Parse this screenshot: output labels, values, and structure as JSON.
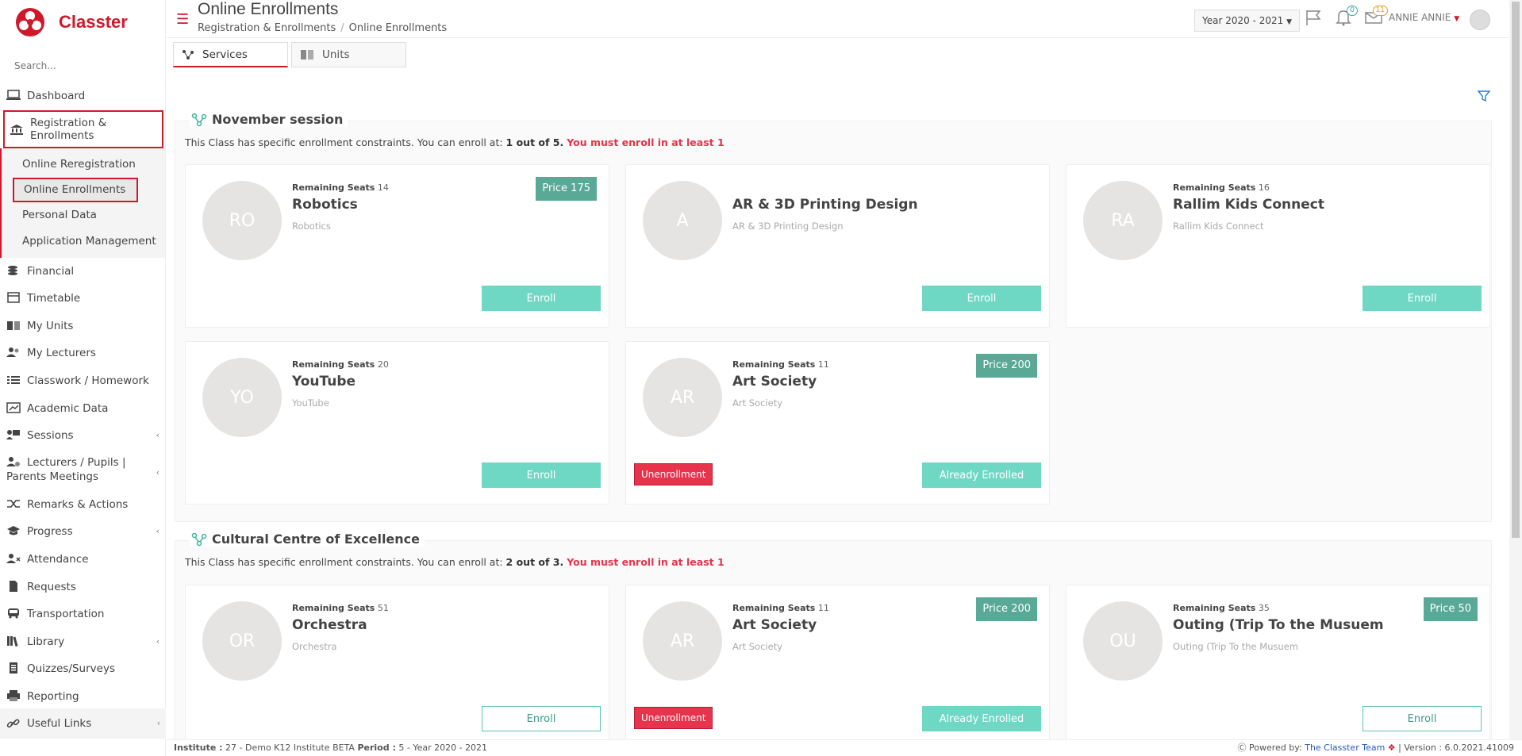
{
  "app": {
    "brand": "Classter"
  },
  "sidebar": {
    "search_placeholder": "Search...",
    "items": [
      {
        "label": "Dashboard"
      },
      {
        "label": "Registration & Enrollments"
      },
      {
        "label": "Financial"
      },
      {
        "label": "Timetable"
      },
      {
        "label": "My Units"
      },
      {
        "label": "My Lecturers"
      },
      {
        "label": "Classwork / Homework"
      },
      {
        "label": "Academic Data"
      },
      {
        "label": "Sessions"
      },
      {
        "label": "Lecturers / Pupils | Parents Meetings"
      },
      {
        "label": "Remarks & Actions"
      },
      {
        "label": "Progress"
      },
      {
        "label": "Attendance"
      },
      {
        "label": "Requests"
      },
      {
        "label": "Transportation"
      },
      {
        "label": "Library"
      },
      {
        "label": "Quizzes/Surveys"
      },
      {
        "label": "Reporting"
      }
    ],
    "sub_items": [
      {
        "label": "Online Reregistration"
      },
      {
        "label": "Online Enrollments"
      },
      {
        "label": "Personal Data"
      },
      {
        "label": "Application Management"
      }
    ],
    "useful_links": "Useful Links"
  },
  "header": {
    "title": "Online Enrollments",
    "breadcrumb": [
      "Registration & Enrollments",
      "Online Enrollments"
    ],
    "year_select": "Year 2020 - 2021",
    "notifications_count": "0",
    "messages_count": "11",
    "user_name": "ANNIE ANNIE"
  },
  "tabs": [
    {
      "label": "Services"
    },
    {
      "label": "Units"
    }
  ],
  "sessions": [
    {
      "title": "November session",
      "constraint_prefix": "This Class has specific enrollment constraints. You can enroll at:",
      "constraint_value": "1 out of 5.",
      "constraint_must": "You must enroll in at least 1",
      "cards": [
        {
          "initials": "RO",
          "seats_label": "Remaining Seats",
          "seats": "14",
          "name": "Robotics",
          "sub": "Robotics",
          "price": "Price 175",
          "button": "Enroll"
        },
        {
          "initials": "A",
          "seats_label": "",
          "seats": "",
          "name": "AR & 3D Printing Design",
          "sub": "AR & 3D Printing Design",
          "price": "",
          "button": "Enroll"
        },
        {
          "initials": "RA",
          "seats_label": "Remaining Seats",
          "seats": "16",
          "name": "Rallim Kids Connect",
          "sub": "Rallim Kids Connect",
          "price": "",
          "button": "Enroll"
        },
        {
          "initials": "YO",
          "seats_label": "Remaining Seats",
          "seats": "20",
          "name": "YouTube",
          "sub": "YouTube",
          "price": "",
          "button": "Enroll"
        },
        {
          "initials": "AR",
          "seats_label": "Remaining Seats",
          "seats": "11",
          "name": "Art Society",
          "sub": "Art Society",
          "price": "Price 200",
          "button": "Already Enrolled",
          "unenroll": "Unenrollment"
        }
      ]
    },
    {
      "title": "Cultural Centre of Excellence",
      "constraint_prefix": "This Class has specific enrollment constraints. You can enroll at:",
      "constraint_value": "2 out of 3.",
      "constraint_must": "You must enroll in at least 1",
      "cards": [
        {
          "initials": "OR",
          "seats_label": "Remaining Seats",
          "seats": "51",
          "name": "Orchestra",
          "sub": "Orchestra",
          "price": "",
          "button": "Enroll"
        },
        {
          "initials": "AR",
          "seats_label": "Remaining Seats",
          "seats": "11",
          "name": "Art Society",
          "sub": "Art Society",
          "price": "Price 200",
          "button": "Already Enrolled",
          "unenroll": "Unenrollment"
        },
        {
          "initials": "OU",
          "seats_label": "Remaining Seats",
          "seats": "35",
          "name": "Outing (Trip To the Musuem",
          "sub": "Outing (Trip To the Musuem",
          "price": "Price 50",
          "button": "Enroll"
        }
      ]
    }
  ],
  "footer": {
    "institute_label": "Institute :",
    "institute_value": "27 - Demo K12 Institute BETA",
    "period_label": "Period :",
    "period_value": "5 - Year 2020 - 2021",
    "powered_label": "Powered by:",
    "powered_link": "The Classter Team",
    "version": "| Version : 6.0.2021.41009"
  },
  "colors": {
    "brand": "#d1182b",
    "enroll": "#6fd8c5",
    "price": "#5aa896",
    "unenroll": "#e8334d"
  }
}
